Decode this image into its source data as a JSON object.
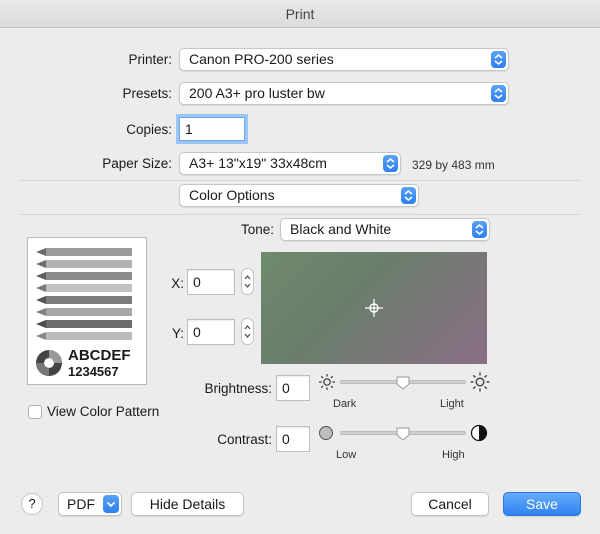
{
  "window": {
    "title": "Print"
  },
  "printer": {
    "label": "Printer:",
    "value": "Canon PRO-200 series"
  },
  "presets": {
    "label": "Presets:",
    "value": "200 A3+ pro luster bw"
  },
  "copies": {
    "label": "Copies:",
    "value": "1"
  },
  "paper_size": {
    "label": "Paper Size:",
    "value": "A3+ 13\"x19\" 33x48cm",
    "dimensions": "329 by 483 mm"
  },
  "section": {
    "value": "Color Options"
  },
  "tone": {
    "label": "Tone:",
    "value": "Black and White"
  },
  "x_field": {
    "label": "X:",
    "value": "0"
  },
  "y_field": {
    "label": "Y:",
    "value": "0"
  },
  "preview": {
    "line1": "ABCDEF",
    "line2": "1234567"
  },
  "brightness": {
    "label": "Brightness:",
    "value": "0",
    "min_label": "Dark",
    "max_label": "Light",
    "level_percent": 50
  },
  "contrast": {
    "label": "Contrast:",
    "value": "0",
    "min_label": "Low",
    "max_label": "High",
    "level_percent": 50
  },
  "view_color_pattern": {
    "label": "View Color Pattern",
    "checked": false
  },
  "footer": {
    "help_label": "?",
    "pdf_label": "PDF",
    "hide_details_label": "Hide Details",
    "cancel_label": "Cancel",
    "save_label": "Save"
  },
  "colors": {
    "accent": "#2f82f2",
    "focus_ring": "#9cc4f5"
  }
}
